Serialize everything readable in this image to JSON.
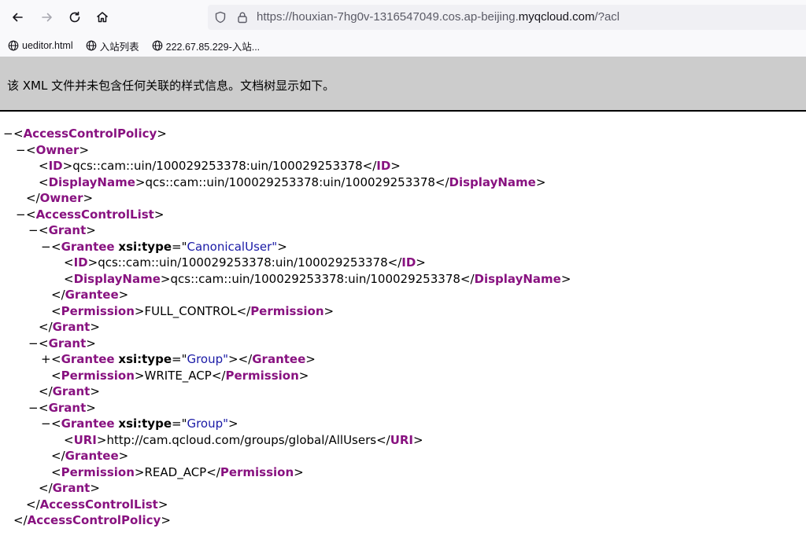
{
  "browser": {
    "url_prefix": "https://houxian-7hg0v-1316547049.cos.ap-beijing.",
    "url_host": "myqcloud.com",
    "url_suffix": "/?acl",
    "bookmarks": [
      {
        "label": "ueditor.html"
      },
      {
        "label": "入站列表"
      },
      {
        "label": "222.67.85.229-入站..."
      }
    ]
  },
  "banner": {
    "message": "该 XML 文件并未包含任何关联的样式信息。文档树显示如下。"
  },
  "xml": {
    "root_tag": "AccessControlPolicy",
    "owner_tag": "Owner",
    "id_tag": "ID",
    "display_name_tag": "DisplayName",
    "owner_id": "qcs::cam::uin/100029253378:uin/100029253378",
    "owner_display_name": "qcs::cam::uin/100029253378:uin/100029253378",
    "acl_tag": "AccessControlList",
    "grant_tag": "Grant",
    "grantee_tag": "Grantee",
    "attr_name": "xsi:type",
    "permission_tag": "Permission",
    "uri_tag": "URI",
    "grants": [
      {
        "grantee_type": "CanonicalUser",
        "grantee_id": "qcs::cam::uin/100029253378:uin/100029253378",
        "grantee_display_name": "qcs::cam::uin/100029253378:uin/100029253378",
        "permission": "FULL_CONTROL"
      },
      {
        "grantee_type": "Group",
        "permission": "WRITE_ACP"
      },
      {
        "grantee_type": "Group",
        "grantee_uri": "http://cam.qcloud.com/groups/global/AllUsers",
        "permission": "READ_ACP"
      }
    ],
    "collapse_glyph": "−",
    "expand_glyph": "+"
  }
}
